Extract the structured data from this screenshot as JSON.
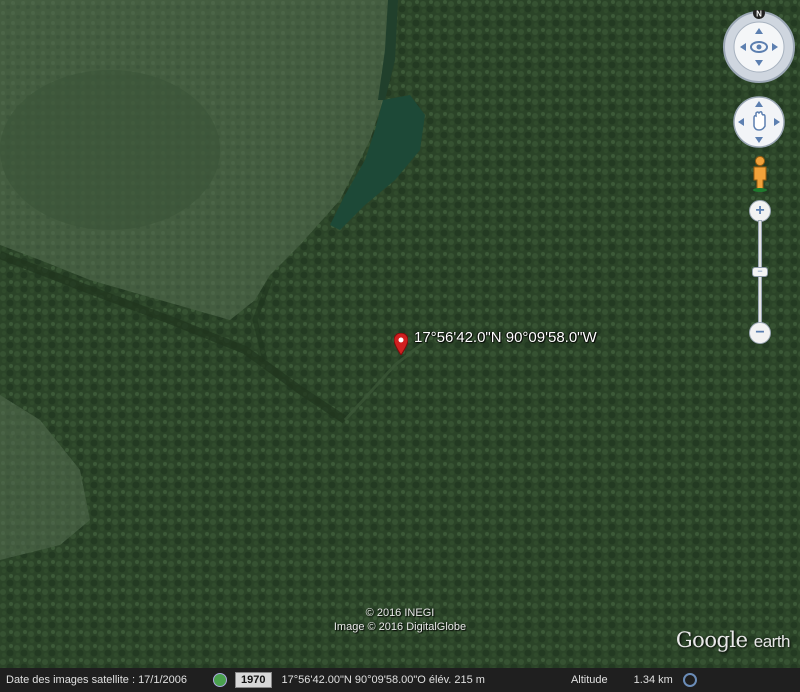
{
  "marker": {
    "label": "17°56'42.0\"N 90°09'58.0\"W",
    "icon": "map-pin-icon",
    "color": "#d02020"
  },
  "copyright": {
    "line1": "© 2016 INEGI",
    "line2": "Image © 2016 DigitalGlobe"
  },
  "logo": {
    "brand": "Google",
    "product": "earth"
  },
  "controls": {
    "compass_letter": "N",
    "zoom_in": "+",
    "zoom_out": "−",
    "zoom_mid": "−"
  },
  "status_bar": {
    "imagery_date_label": "Date des images satellite : 17/1/2006",
    "historical_year": "1970",
    "coordinates": "17°56'42.00\"N  90°09'58.00\"O  élév.  215 m",
    "altitude_label": "Altitude",
    "altitude_value": "1.34 km"
  },
  "colors": {
    "forest": "#2f4a2c",
    "clearing": "#4b6347",
    "water": "#1e4a38",
    "accent": "#5c7fb0"
  }
}
